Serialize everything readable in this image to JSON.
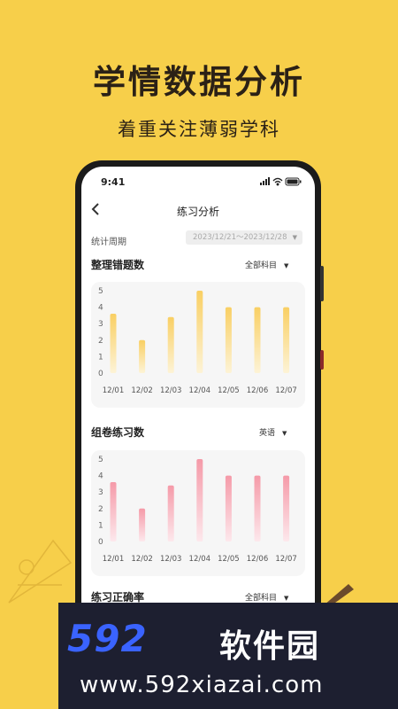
{
  "promo": {
    "headline": "学情数据分析",
    "subline": "着重关注薄弱学科"
  },
  "status_bar": {
    "time": "9:41",
    "icons": [
      "signal-icon",
      "wifi-icon",
      "battery-icon"
    ]
  },
  "nav": {
    "back_icon": "chevron-left-icon",
    "title": "练习分析"
  },
  "period": {
    "label": "统计周期",
    "value": "2023/12/21～2023/12/28"
  },
  "sections": [
    {
      "title": "整理错题数",
      "filter": "全部科目",
      "bar_color_top": "#f9cf63",
      "bar_color_bottom": "#fdf3d6"
    },
    {
      "title": "组卷练习数",
      "filter": "英语",
      "bar_color_top": "#f59aa8",
      "bar_color_bottom": "#fde8ec"
    },
    {
      "title": "练习正确率",
      "filter": "全部科目"
    }
  ],
  "chart_data": [
    {
      "type": "bar",
      "title": "整理错题数",
      "categories": [
        "12/01",
        "12/02",
        "12/03",
        "12/04",
        "12/05",
        "12/06",
        "12/07"
      ],
      "values": [
        3.6,
        2.0,
        3.4,
        5.0,
        4.0,
        4.0,
        4.0
      ],
      "y_ticks": [
        "0",
        "1",
        "2",
        "3",
        "4",
        "5"
      ],
      "ylim": [
        0,
        5
      ],
      "grid": false
    },
    {
      "type": "bar",
      "title": "组卷练习数",
      "categories": [
        "12/01",
        "12/02",
        "12/03",
        "12/04",
        "12/05",
        "12/06",
        "12/07"
      ],
      "values": [
        3.6,
        2.0,
        3.4,
        5.0,
        4.0,
        4.0,
        4.0
      ],
      "y_ticks": [
        "0",
        "1",
        "2",
        "3",
        "4",
        "5"
      ],
      "ylim": [
        0,
        5
      ],
      "grid": false
    }
  ],
  "banner": {
    "brand_number": "592",
    "brand_text": "软件园",
    "url": "www.592xiazai.com",
    "brand_color": "#3a63ff"
  }
}
